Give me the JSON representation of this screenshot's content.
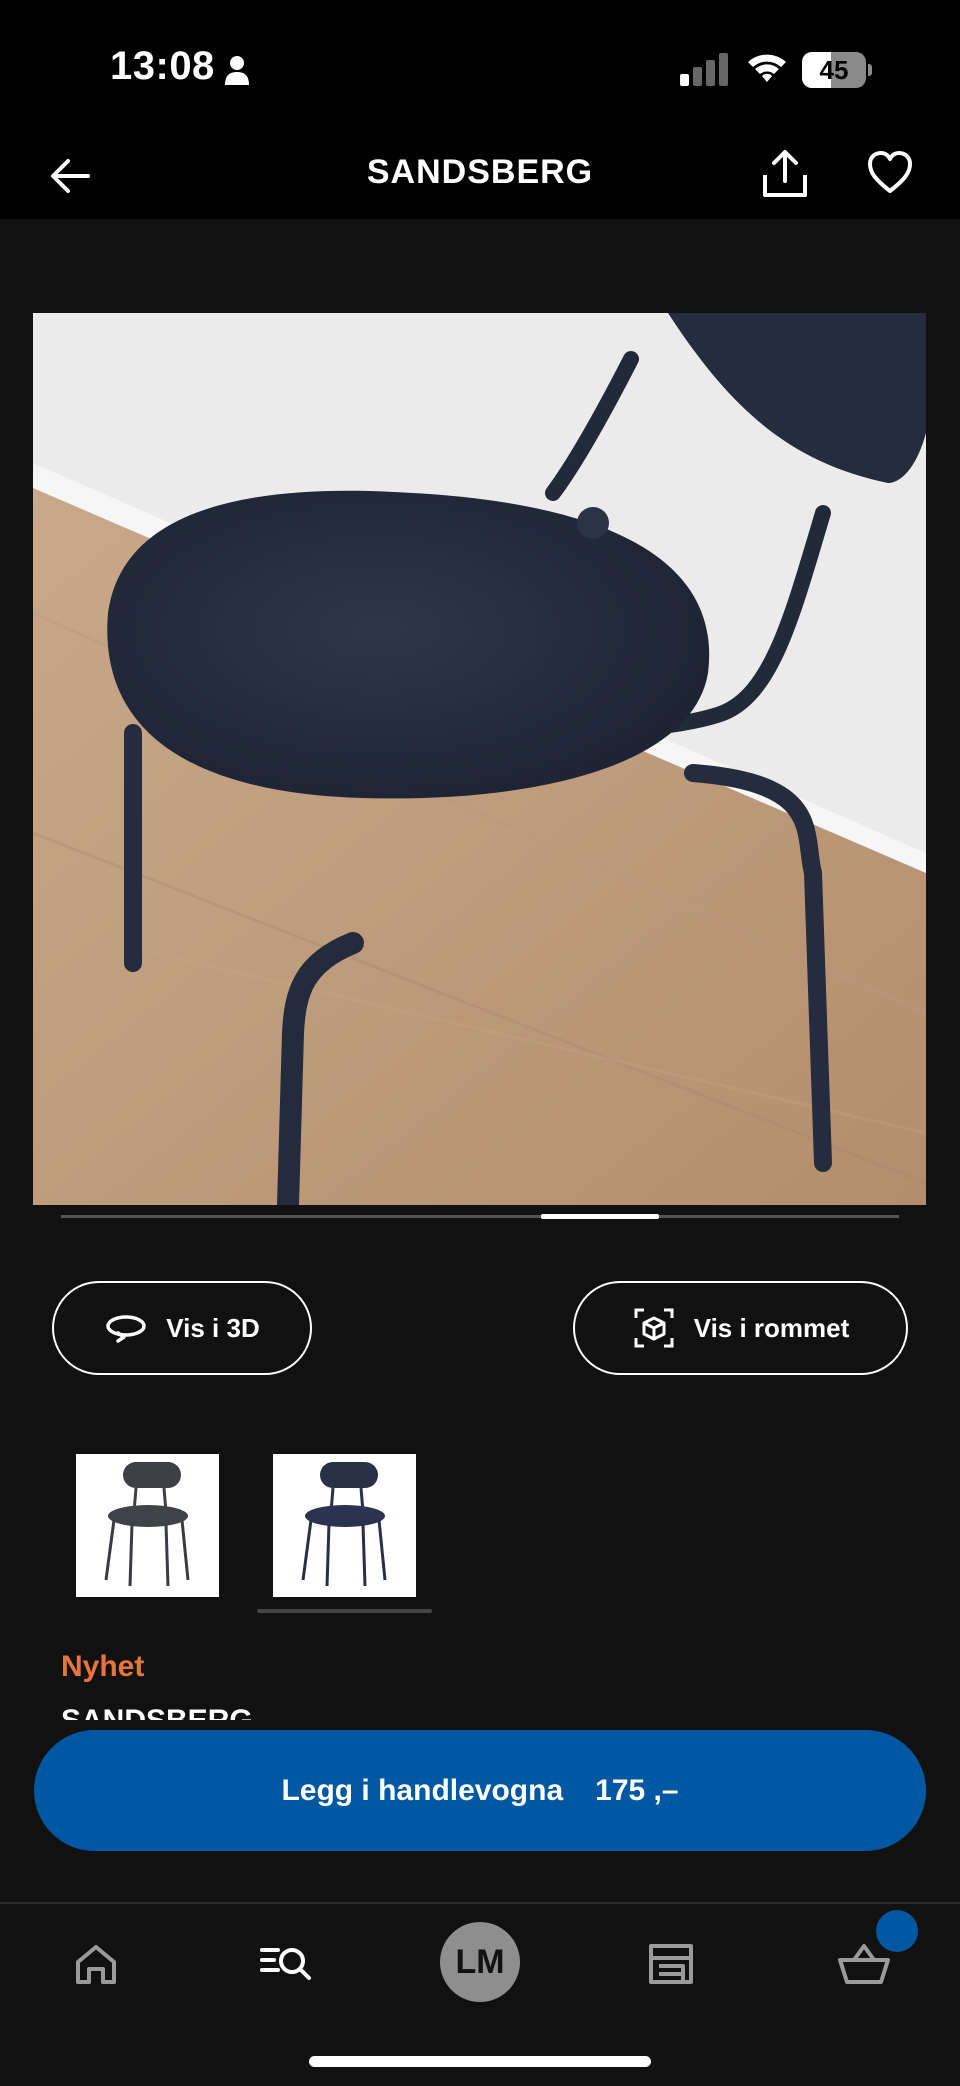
{
  "status_bar": {
    "time": "13:08",
    "battery_level": "45",
    "battery_fraction": 0.45
  },
  "header": {
    "title": "SANDSBERG"
  },
  "gallery": {
    "image_count": 2,
    "active_index": 1
  },
  "actions": {
    "view_3d_label": "Vis i 3D",
    "view_in_room_label": "Vis i rommet"
  },
  "variants": [
    {
      "name": "dark-grey-variant",
      "selected": false
    },
    {
      "name": "dark-blue-variant",
      "selected": true
    }
  ],
  "product": {
    "badge": "Nyhet",
    "name": "SANDSBERG"
  },
  "cart_button": {
    "label": "Legg i handlevogna",
    "price": "175 ,–"
  },
  "bottom_nav": {
    "avatar_initials": "LM"
  },
  "colors": {
    "accent_blue": "#0058a3",
    "new_badge_orange": "#e8733c",
    "background": "#111111"
  }
}
